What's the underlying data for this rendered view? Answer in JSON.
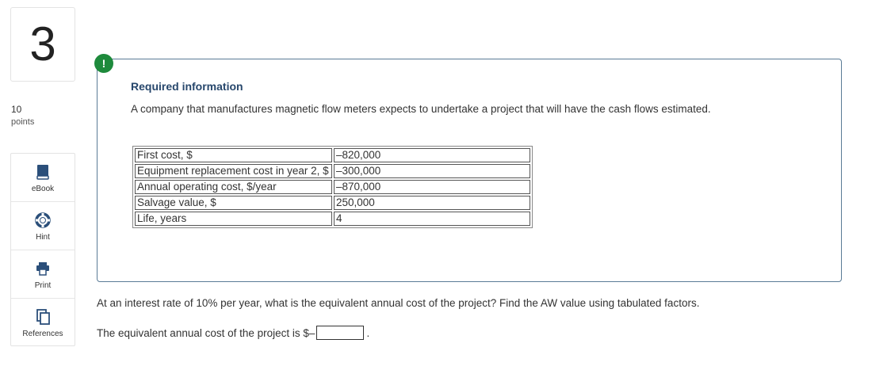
{
  "question": {
    "number": "3",
    "points_value": "10",
    "points_label": "points"
  },
  "tools": [
    {
      "label": "eBook",
      "icon": "book-icon"
    },
    {
      "label": "Hint",
      "icon": "lifebuoy-icon"
    },
    {
      "label": "Print",
      "icon": "printer-icon"
    },
    {
      "label": "References",
      "icon": "documents-icon"
    }
  ],
  "alert": {
    "symbol": "!",
    "color": "#1e8a3c"
  },
  "info": {
    "title": "Required information",
    "description": "A company that manufactures magnetic flow meters expects to undertake a project that will have the cash flows estimated.",
    "rows": [
      {
        "label": "First cost, $",
        "value": "–820,000"
      },
      {
        "label": "Equipment replacement cost in year 2, $",
        "value": "–300,000"
      },
      {
        "label": "Annual operating cost, $/year",
        "value": "–870,000"
      },
      {
        "label": "Salvage value, $",
        "value": "250,000"
      },
      {
        "label": "Life, years",
        "value": "4"
      }
    ]
  },
  "prompt": "At an interest rate of 10% per year, what is the equivalent annual cost of the project? Find the AW value using tabulated factors.",
  "answer": {
    "prefix": "The equivalent annual cost of the project is $–",
    "value": "",
    "suffix": "."
  },
  "colors": {
    "title": "#27476c",
    "box_border": "#5a7b96"
  }
}
